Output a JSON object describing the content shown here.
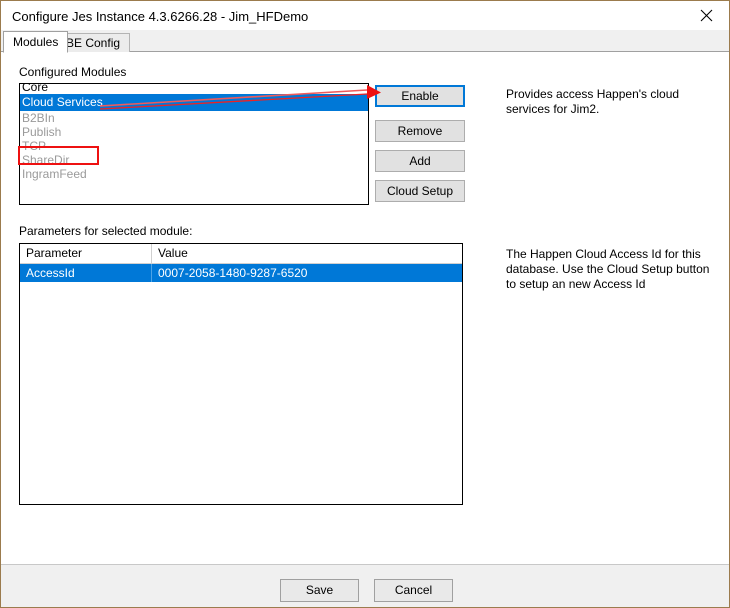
{
  "window": {
    "title": "Configure Jes Instance 4.3.6266.28 - Jim_HFDemo",
    "close_icon": "close-icon"
  },
  "tabs": [
    {
      "label": "Modules",
      "active": true
    },
    {
      "label": "BE Config",
      "active": false
    }
  ],
  "modules_section": {
    "label": "Configured Modules",
    "items": [
      {
        "label": "Core",
        "state": "enabled"
      },
      {
        "label": "Cloud Services",
        "state": "selected"
      },
      {
        "label": "B2BIn",
        "state": "disabled"
      },
      {
        "label": "Publish",
        "state": "disabled"
      },
      {
        "label": "TCP",
        "state": "disabled"
      },
      {
        "label": "ShareDir",
        "state": "disabled"
      },
      {
        "label": "IngramFeed",
        "state": "disabled"
      }
    ]
  },
  "module_buttons": [
    {
      "label": "Enable",
      "focused": true
    },
    {
      "label": "Remove",
      "focused": false
    },
    {
      "label": "Add",
      "focused": false
    },
    {
      "label": "Cloud Setup",
      "focused": false
    }
  ],
  "module_help": "Provides access Happen's cloud services for Jim2.",
  "params_section": {
    "label": "Parameters for selected module:",
    "columns": [
      "Parameter",
      "Value"
    ],
    "rows": [
      {
        "parameter": "AccessId",
        "value": "0007-2058-1480-9287-6520",
        "selected": true
      }
    ]
  },
  "params_help": "The Happen Cloud Access Id for this database.  Use the Cloud Setup button to setup an new Access Id",
  "footer_buttons": [
    {
      "label": "Save"
    },
    {
      "label": "Cancel"
    }
  ],
  "colors": {
    "selection_blue": "#0078d7",
    "annotation_red": "#ee1111",
    "disabled_gray": "#9a9a9a"
  }
}
